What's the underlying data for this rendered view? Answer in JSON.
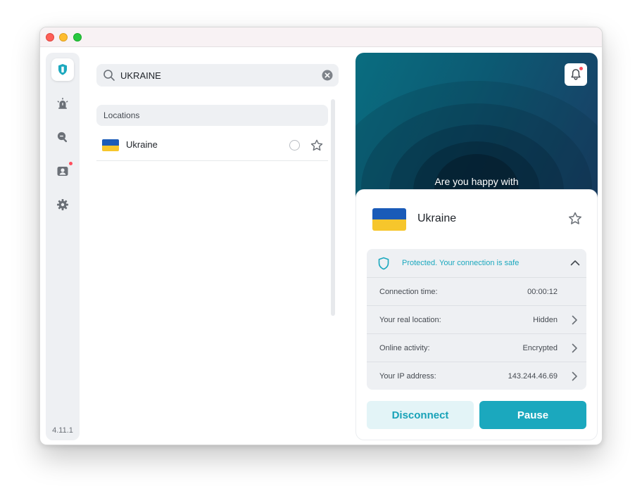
{
  "window": {
    "traffic_lights": [
      "close",
      "minimize",
      "zoom"
    ]
  },
  "sidebar": {
    "items": [
      {
        "icon": "shield-icon",
        "active": true
      },
      {
        "icon": "alarm-icon",
        "active": false
      },
      {
        "icon": "search-zoom-icon",
        "active": false
      },
      {
        "icon": "profile-icon",
        "active": false,
        "badge": true
      },
      {
        "icon": "gear-icon",
        "active": false
      }
    ],
    "version": "4.11.1"
  },
  "search": {
    "value": "UKRAINE",
    "placeholder": ""
  },
  "locations": {
    "header": "Locations",
    "items": [
      {
        "name": "Ukraine",
        "flag": "ukraine-flag"
      }
    ]
  },
  "hero": {
    "text": "Are you happy with",
    "notification_badge": true
  },
  "connection": {
    "country": "Ukraine",
    "status_text": "Protected. Your connection is safe",
    "rows": [
      {
        "label": "Connection time:",
        "value": "00:00:12"
      },
      {
        "label": "Your real location:",
        "value": "Hidden"
      },
      {
        "label": "Online activity:",
        "value": "Encrypted"
      },
      {
        "label": "Your IP address:",
        "value": "143.244.46.69"
      }
    ]
  },
  "buttons": {
    "disconnect": "Disconnect",
    "pause": "Pause"
  },
  "colors": {
    "accent": "#1ba8be",
    "badge": "#ff4d5c",
    "flag_blue": "#1a5bb8",
    "flag_yellow": "#f6c62c"
  }
}
